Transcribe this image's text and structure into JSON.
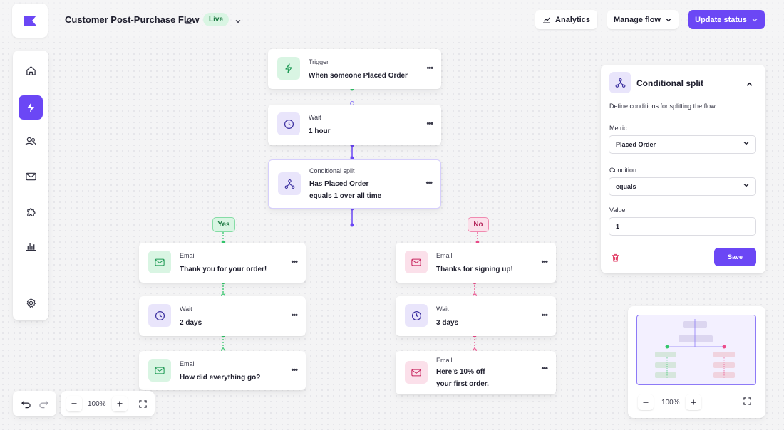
{
  "header": {
    "flow_title": "Customer Post-Purchase Flow",
    "status_badge": "Live",
    "analytics_label": "Analytics",
    "manage_flow_label": "Manage flow",
    "update_status_label": "Update status"
  },
  "sidebar": {
    "items": [
      {
        "icon": "home-icon"
      },
      {
        "icon": "bolt-icon",
        "active": true
      },
      {
        "icon": "users-icon"
      },
      {
        "icon": "mail-icon"
      },
      {
        "icon": "puzzle-icon"
      },
      {
        "icon": "bar-chart-icon"
      },
      {
        "icon": "gear-icon"
      }
    ]
  },
  "flow": {
    "trigger": {
      "type": "Trigger",
      "title": "When someone Placed Order"
    },
    "wait1": {
      "type": "Wait",
      "title": "1 hour"
    },
    "split": {
      "type": "Conditional split",
      "title_line1": "Has Placed Order",
      "title_line2": "equals 1 over all time"
    },
    "yes_label": "Yes",
    "no_label": "No",
    "yes_branch": [
      {
        "type": "Email",
        "title": "Thank you for your order!"
      },
      {
        "type": "Wait",
        "title": "2 days"
      },
      {
        "type": "Email",
        "title": "How did everything go?"
      }
    ],
    "no_branch": [
      {
        "type": "Email",
        "title": "Thanks for signing up!"
      },
      {
        "type": "Wait",
        "title": "3 days"
      },
      {
        "type": "Email",
        "title_line1": "Here’s 10% off",
        "title_line2": "your first order."
      }
    ],
    "menu_glyph": "•••"
  },
  "panel": {
    "title": "Conditional split",
    "description": "Define conditions for splitting the flow.",
    "metric_label": "Metric",
    "metric_value": "Placed Order",
    "condition_label": "Condition",
    "condition_value": "equals",
    "value_label": "Value",
    "value_value": "1",
    "save_label": "Save"
  },
  "minimap": {
    "zoom": "100%"
  },
  "canvas_controls": {
    "zoom": "100%"
  },
  "colors": {
    "accent": "#6b47f5",
    "yes_green": "#34c66b",
    "no_pink": "#ec4c8a"
  }
}
